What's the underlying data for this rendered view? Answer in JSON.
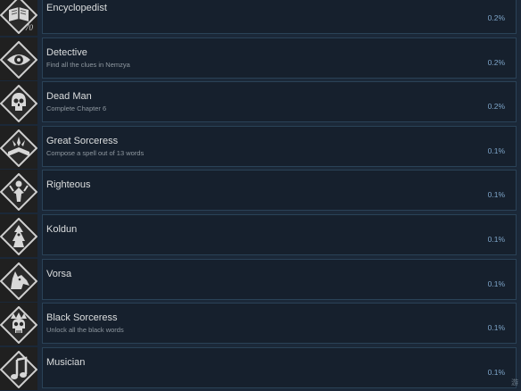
{
  "achievements": [
    {
      "title": "Encyclopedist",
      "description": "",
      "percent": "0.2%",
      "icon": "book-icon",
      "badge": "70"
    },
    {
      "title": "Detective",
      "description": "Find all the clues in Nemzya",
      "percent": "0.2%",
      "icon": "eye-icon"
    },
    {
      "title": "Dead Man",
      "description": "Complete Chapter 6",
      "percent": "0.2%",
      "icon": "skull-icon"
    },
    {
      "title": "Great Sorceress",
      "description": "Compose a spell out of 13 words",
      "percent": "0.1%",
      "icon": "spellbook-icon"
    },
    {
      "title": "Righteous",
      "description": "",
      "percent": "0.1%",
      "icon": "figure-icon"
    },
    {
      "title": "Koldun",
      "description": "",
      "percent": "0.1%",
      "icon": "sorcerer-icon"
    },
    {
      "title": "Vorsa",
      "description": "",
      "percent": "0.1%",
      "icon": "wolf-icon"
    },
    {
      "title": "Black Sorceress",
      "description": "Unlock all the black words",
      "percent": "0.1%",
      "icon": "dark-skull-icon"
    },
    {
      "title": "Musician",
      "description": "",
      "percent": "0.1%",
      "icon": "music-note-icon"
    }
  ],
  "watermark": "游"
}
